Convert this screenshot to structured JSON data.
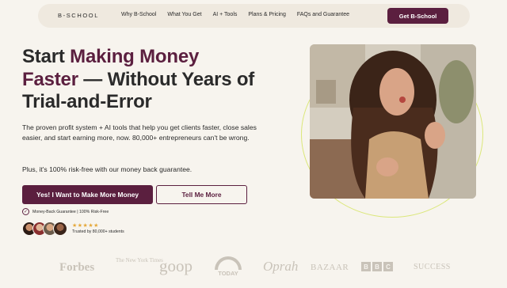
{
  "nav": {
    "logo": "B-SCHOOL",
    "links": [
      "Why B-School",
      "What You Get",
      "AI + Tools",
      "Plans & Pricing",
      "FAQs and Guarantee"
    ],
    "cta": "Get B-School"
  },
  "hero": {
    "headline_part1": "Start ",
    "headline_highlight1": "Making Money",
    "headline_highlight2": "Faster",
    "headline_part2": " — Without Years of Trial-and-Error",
    "subhead": "The proven profit system + AI tools that help you get clients faster, close sales easier, and start earning more, now. 80,000+ entrepreneurs can't be wrong.",
    "plus": "Plus, it's 100% risk-free with our money back guarantee.",
    "primary_cta": "Yes! I Want to Make More Money",
    "secondary_cta": "Tell Me More",
    "guarantee": "Money-Back Guarantee | 100% Risk-Free",
    "stars": "★★★★★",
    "trusted": "Trusted by 80,000+ students"
  },
  "press": {
    "forbes": "Forbes",
    "nyt": "The New York Times",
    "goop": "goop",
    "today": "TODAY",
    "oprah": "Oprah",
    "bazaar": "BAZAAR",
    "bbc": [
      "B",
      "B",
      "C"
    ],
    "success": "SUCCESS"
  },
  "colors": {
    "brand": "#5b1f3f",
    "background": "#f7f4ee",
    "accent_ring": "#dbe77a",
    "stars": "#e5a83a"
  }
}
